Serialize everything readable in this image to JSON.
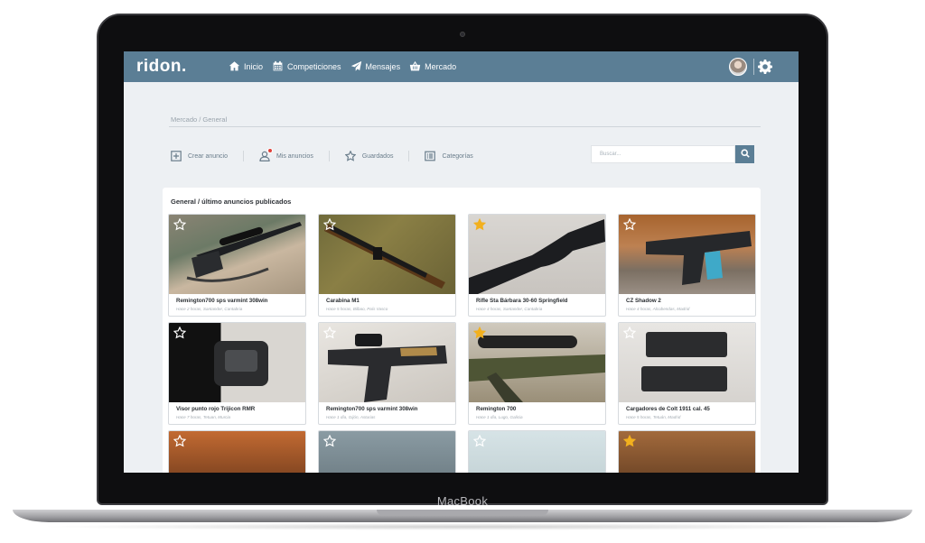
{
  "device": {
    "label": "MacBook"
  },
  "app": {
    "logo": "ridon.",
    "nav": [
      {
        "label": "Inicio",
        "icon": "home-icon"
      },
      {
        "label": "Competiciones",
        "icon": "calendar-icon"
      },
      {
        "label": "Mensajes",
        "icon": "paper-plane-icon"
      },
      {
        "label": "Mercado",
        "icon": "basket-icon"
      }
    ],
    "header_icons": [
      "avatar",
      "gear-icon"
    ]
  },
  "breadcrumb": "Mercado / General",
  "toolbar": {
    "items": [
      {
        "label": "Crear anuncio",
        "icon": "plus-square-icon"
      },
      {
        "label": "Mis anuncios",
        "icon": "user-icon"
      },
      {
        "label": "Guardados",
        "icon": "star-icon"
      },
      {
        "label": "Categorías",
        "icon": "list-icon"
      }
    ]
  },
  "search": {
    "placeholder": "Buscar..."
  },
  "panel": {
    "title": "General / último anuncios publicados"
  },
  "colors": {
    "header": "#5b7e95",
    "star_active": "#f2b01e",
    "notification": "#e0413a"
  },
  "listings": [
    {
      "title": "Remington700 sps varmint 308win",
      "meta": "Hace 2 horas, Santander, Cantabria",
      "starred": false
    },
    {
      "title": "Carabina M1",
      "meta": "Hace 5 horas, Bilbao, País Vasco",
      "starred": false
    },
    {
      "title": "Rifle Sta Bárbara 30-60 Springfield",
      "meta": "Hace 4 horas, Santander, Cantabria",
      "starred": true
    },
    {
      "title": "CZ Shadow 2",
      "meta": "Hace 4 horas, Alcobendas, Madrid",
      "starred": false
    },
    {
      "title": "Visor punto rojo Trijicon RMR",
      "meta": "Hace 7 horas, Tetuan, Murcia",
      "starred": false
    },
    {
      "title": "Remington700 sps varmint 308win",
      "meta": "Hace 1 día, Gijón, Asturias",
      "starred": false
    },
    {
      "title": "Remington 700",
      "meta": "Hace 1 día, Lugo, Galicia",
      "starred": true
    },
    {
      "title": "Cargadores de Colt 1911 cal. 45",
      "meta": "Hace 5 horas, Tetuán, Madrid",
      "starred": false
    },
    {
      "title": "",
      "meta": "",
      "starred": false
    },
    {
      "title": "",
      "meta": "",
      "starred": false
    },
    {
      "title": "",
      "meta": "",
      "starred": false
    },
    {
      "title": "",
      "meta": "",
      "starred": true
    }
  ]
}
